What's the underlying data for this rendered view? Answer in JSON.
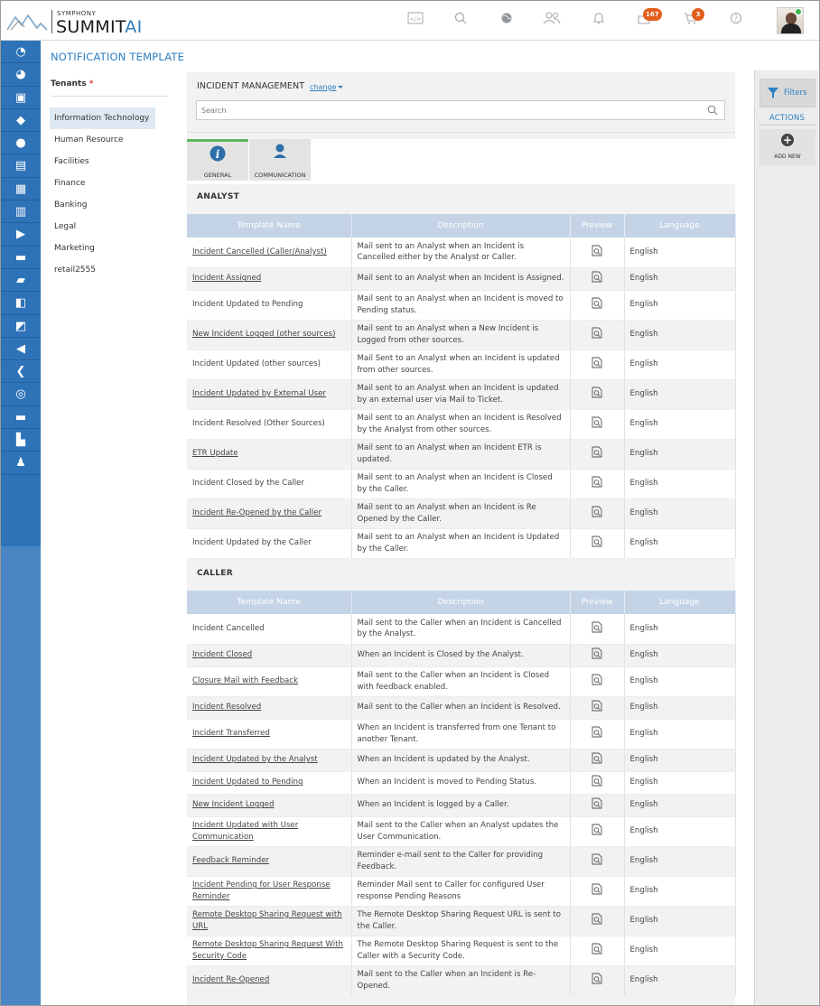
{
  "brand": {
    "tagline": "SYMPHONY",
    "name_main": "SUMMIT",
    "name_accent": "AI"
  },
  "header": {
    "icons": [
      {
        "name": "code-icon",
        "badge": ""
      },
      {
        "name": "search-icon",
        "badge": ""
      },
      {
        "name": "globe-icon",
        "badge": ""
      },
      {
        "name": "users-icon",
        "badge": ""
      },
      {
        "name": "bell-icon",
        "badge": ""
      },
      {
        "name": "ticket-icon",
        "badge": "167"
      },
      {
        "name": "cart-icon",
        "badge": "3"
      },
      {
        "name": "help-icon",
        "badge": ""
      }
    ],
    "status_color": "#3cb54a",
    "badge_color": "#e35d1c"
  },
  "sidebar": {
    "icons": [
      "dashboard-icon",
      "chart-pie-icon",
      "monitor-icon",
      "tag-icon",
      "headset-icon",
      "edit-doc-icon",
      "building-icon",
      "cart-icon",
      "document-arrow-icon",
      "database-icon",
      "printer-icon",
      "clipboard-icon",
      "user-doc-icon",
      "inbox-arrow-icon",
      "gavel-icon",
      "gauge-icon",
      "briefcase-icon",
      "report-icon",
      "admin-user-icon"
    ],
    "accent": "#2e73b8"
  },
  "page": {
    "title": "NOTIFICATION TEMPLATE"
  },
  "tenants": {
    "label": "Tenants",
    "required_mark": "*",
    "items": [
      "Information Technology",
      "Human Resource",
      "Facilities",
      "Finance",
      "Banking",
      "Legal",
      "Marketing",
      "retail2555"
    ],
    "selected": "Information Technology"
  },
  "module": {
    "name": "INCIDENT MANAGEMENT",
    "change_label": "change"
  },
  "search": {
    "placeholder": "Search"
  },
  "tabs": [
    {
      "label": "GENERAL",
      "icon": "info-icon",
      "active": true
    },
    {
      "label": "COMMUNICATION",
      "icon": "person-icon",
      "active": false
    }
  ],
  "columns": [
    "Template Name",
    "Description",
    "Preview",
    "Language"
  ],
  "sections": [
    {
      "title": "ANALYST",
      "rows": [
        {
          "name": "Incident Cancelled (Caller/Analyst)",
          "link": true,
          "description": "Mail sent to an Analyst when an Incident is Cancelled either by the Analyst or Caller.",
          "language": "English"
        },
        {
          "name": "Incident Assigned",
          "link": true,
          "description": "Mail sent to an Analyst when an Incident is Assigned.",
          "language": "English"
        },
        {
          "name": "Incident Updated to Pending",
          "link": false,
          "description": "Mail sent to an Analyst when an Incident is moved to Pending status.",
          "language": "English"
        },
        {
          "name": "New Incident Logged (other sources)",
          "link": true,
          "description": "Mail sent to an Analyst when a New Incident is Logged from other sources.",
          "language": "English"
        },
        {
          "name": "Incident Updated (other sources)",
          "link": false,
          "description": "Mail Sent to an Analyst when an Incident is updated from other sources.",
          "language": "English"
        },
        {
          "name": "Incident Updated by External User",
          "link": true,
          "description": "Mail sent to an Analyst when an Incident is updated by an external user via Mail to Ticket.",
          "language": "English"
        },
        {
          "name": "Incident Resolved (Other Sources)",
          "link": false,
          "description": "Mail sent to an Analyst when an Incident is Resolved by the Analyst from other sources.",
          "language": "English"
        },
        {
          "name": "ETR Update",
          "link": true,
          "description": "Mail sent to an Analyst when an Incident ETR is updated.",
          "language": "English"
        },
        {
          "name": "Incident Closed by the Caller",
          "link": false,
          "description": "Mail sent to an Analyst when an Incident is Closed by the Caller.",
          "language": "English"
        },
        {
          "name": "Incident Re-Opened by the Caller",
          "link": true,
          "description": "Mail sent to an Analyst when an Incident is Re Opened by the Caller.",
          "language": "English"
        },
        {
          "name": "Incident Updated by the Caller",
          "link": false,
          "description": "Mail sent to an Analyst when an Incident is Updated by the Caller.",
          "language": "English"
        }
      ]
    },
    {
      "title": "CALLER",
      "rows": [
        {
          "name": "Incident Cancelled",
          "link": false,
          "description": "Mail sent to the Caller when an Incident is Cancelled by the Analyst.",
          "language": "English"
        },
        {
          "name": "Incident Closed",
          "link": true,
          "description": "When an Incident is Closed by the Analyst.",
          "language": "English"
        },
        {
          "name": "Closure Mail with Feedback",
          "link": true,
          "description": "Mail sent to the Caller when an Incident is Closed with feedback enabled.",
          "language": "English"
        },
        {
          "name": "Incident Resolved",
          "link": true,
          "description": "Mail sent to the Caller when an Incident is Resolved.",
          "language": "English"
        },
        {
          "name": "Incident Transferred",
          "link": true,
          "description": "When an Incident is transferred from one Tenant to another Tenant.",
          "language": "English"
        },
        {
          "name": "Incident Updated by the Analyst",
          "link": true,
          "description": "When an Incident is updated by the Analyst.",
          "language": "English"
        },
        {
          "name": "Incident Updated to Pending",
          "link": true,
          "description": "When an Incident is moved to Pending Status.",
          "language": "English"
        },
        {
          "name": "New Incident Logged",
          "link": true,
          "description": "When an Incident is logged by a Caller.",
          "language": "English"
        },
        {
          "name": "Incident Updated with User Communication",
          "link": true,
          "description": "Mail sent to the Caller when an Analyst updates the User Communication.",
          "language": "English"
        },
        {
          "name": "Feedback Reminder",
          "link": true,
          "description": "Reminder e-mail sent to the Caller for providing Feedback.",
          "language": "English"
        },
        {
          "name": "Incident Pending for User Response Reminder",
          "link": true,
          "description": "Reminder Mail sent to Caller for configured User response Pending Reasons",
          "language": "English"
        },
        {
          "name": "Remote Desktop Sharing Request with URL",
          "link": true,
          "description": "The Remote Desktop Sharing Request URL is sent to the Caller.",
          "language": "English"
        },
        {
          "name": "Remote Desktop Sharing Request With Security Code",
          "link": true,
          "description": "The Remote Desktop Sharing Request is sent to the Caller with a Security Code.",
          "language": "English"
        },
        {
          "name": "Incident Re-Opened",
          "link": true,
          "description": "Mail sent to the Caller when an Incident is Re-Opened.",
          "language": "English"
        }
      ]
    }
  ],
  "right_panel": {
    "filters_label": "Filters",
    "actions_label": "ACTIONS",
    "add_new_label": "ADD NEW"
  }
}
